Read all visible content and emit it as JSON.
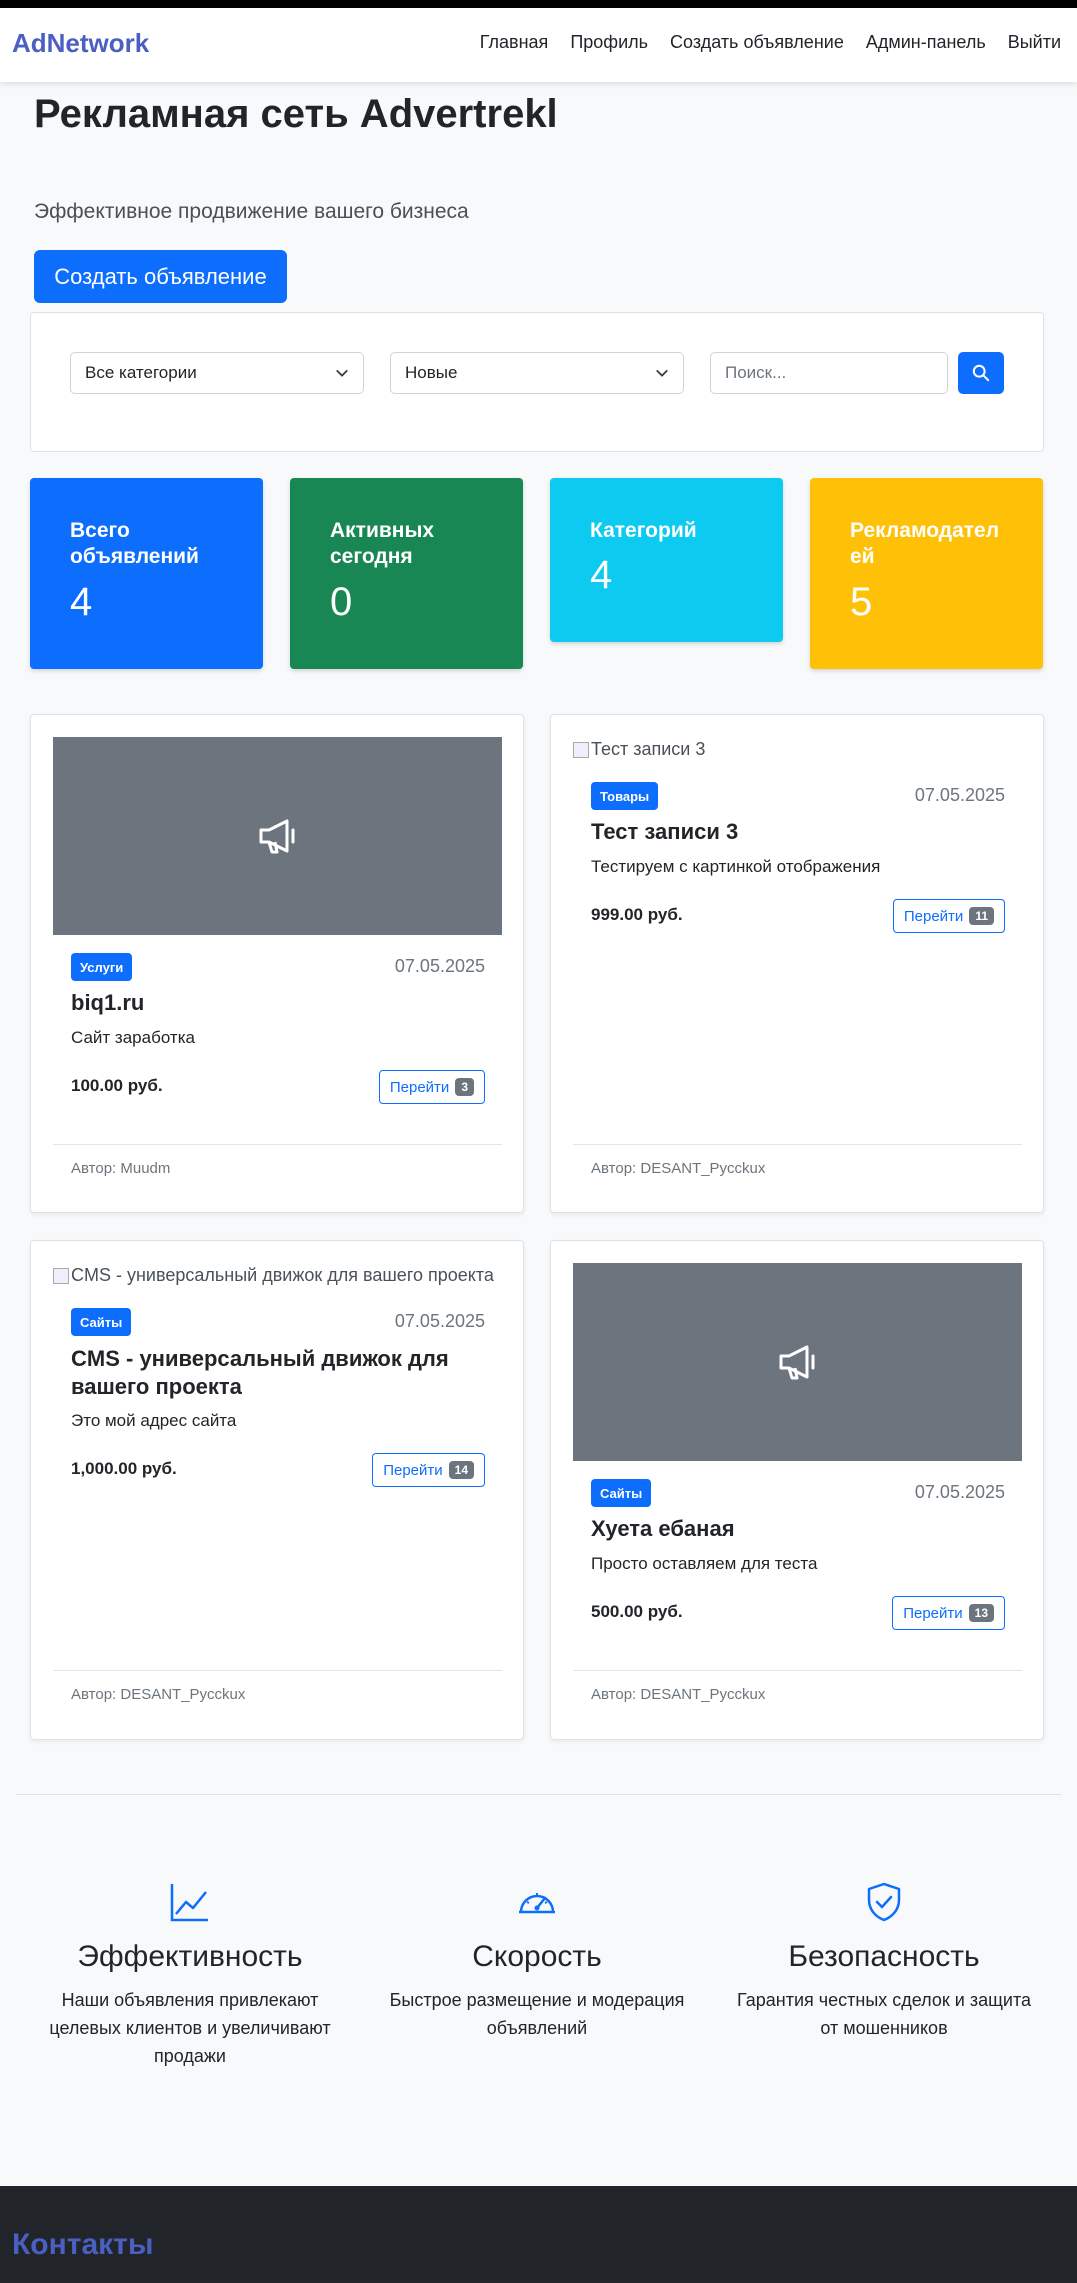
{
  "navbar": {
    "brand": "AdNetwork",
    "links": [
      "Главная",
      "Профиль",
      "Создать объявление",
      "Админ-панель",
      "Выйти"
    ]
  },
  "hero": {
    "title": "Рекламная сеть Advertrekl",
    "subtitle": "Эффективное продвижение вашего бизнеса",
    "cta": "Создать объявление"
  },
  "filters": {
    "category": "Все категории",
    "sort": "Новые",
    "search_placeholder": "Поиск..."
  },
  "stats": [
    {
      "label": "Всего объявлений",
      "value": "4",
      "color": "#0d6efd"
    },
    {
      "label": "Активных сегодня",
      "value": "0",
      "color": "#198754"
    },
    {
      "label": "Категорий",
      "value": "4",
      "color": "#0dcaf0"
    },
    {
      "label": "Рекламодател ей",
      "value": "5",
      "color": "#ffc107"
    }
  ],
  "ads": [
    {
      "image": "placeholder",
      "category": "Услуги",
      "date": "07.05.2025",
      "title": "biq1.ru",
      "description": "Сайт заработка",
      "price": "100.00 руб.",
      "button": "Перейти",
      "clicks": "3",
      "author": "Автор: Muudm"
    },
    {
      "image": "Тест записи 3",
      "category": "Товары",
      "date": "07.05.2025",
      "title": "Тест записи 3",
      "description": "Тестируем с картинкой отображения",
      "price": "999.00 руб.",
      "button": "Перейти",
      "clicks": "11",
      "author": "Автор: DESANT_Pycckux"
    },
    {
      "image": "CMS - универсальный движок для вашего проекта",
      "category": "Сайты",
      "date": "07.05.2025",
      "title": "CMS - универсальный движок для вашего проекта",
      "description": "Это мой адрес сайта",
      "price": "1,000.00 руб.",
      "button": "Перейти",
      "clicks": "14",
      "author": "Автор: DESANT_Pycckux"
    },
    {
      "image": "placeholder",
      "category": "Сайты",
      "date": "07.05.2025",
      "title": "Хуета ебаная",
      "description": "Просто оставляем для теста",
      "price": "500.00 руб.",
      "button": "Перейти",
      "clicks": "13",
      "author": "Автор: DESANT_Pycckux"
    }
  ],
  "features": [
    {
      "icon": "chart-line-icon",
      "title": "Эффективность",
      "text": "Наши объявления привлекают целевых клиентов и увеличивают продажи"
    },
    {
      "icon": "speedometer-icon",
      "title": "Скорость",
      "text": "Быстрое размещение и модерация объявлений"
    },
    {
      "icon": "shield-check-icon",
      "title": "Безопасность",
      "text": "Гарантия честных сделок и защита от мошенников"
    }
  ],
  "footer": {
    "contacts": "Контакты"
  },
  "colors": {
    "brand": "#4a5fc1",
    "primary": "#0d6efd",
    "badge": "#0d6efd",
    "placeholder": "#6c757d",
    "footer": "#212529"
  }
}
